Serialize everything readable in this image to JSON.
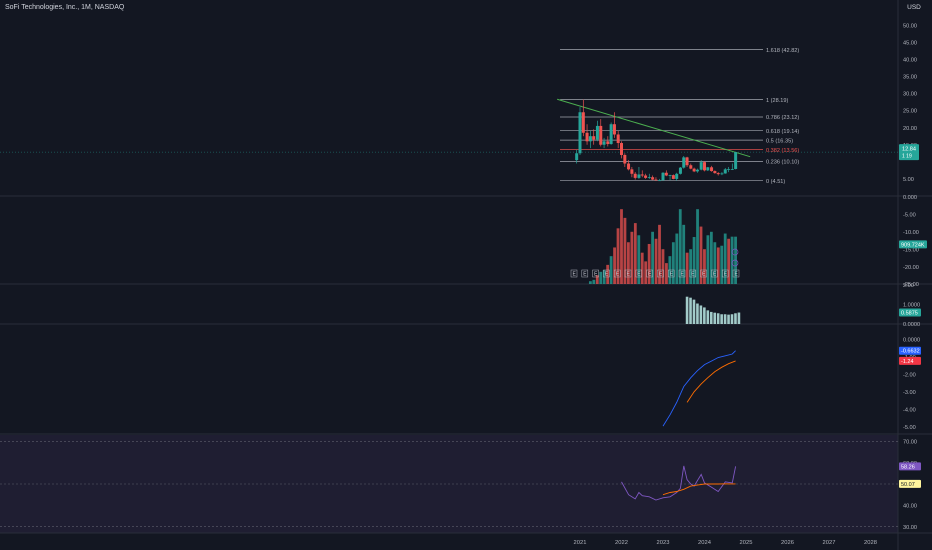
{
  "header": {
    "symbol_title": "SoFi Technologies, Inc., 1M, NASDAQ",
    "currency": "USD"
  },
  "colors": {
    "background": "#131722",
    "up": "#26a69a",
    "down": "#ef5350",
    "fib_line": "#b2b5be",
    "trendline": "#4caf50",
    "macd_line": "#2962ff",
    "signal_line": "#ff6d00",
    "rsi_line": "#7e57c2",
    "rsi_band": "#2a2440"
  },
  "time_axis": {
    "labels": [
      {
        "label": "2021",
        "t": 2021.0
      },
      {
        "label": "2022",
        "t": 2022.0
      },
      {
        "label": "2023",
        "t": 2023.0
      },
      {
        "label": "2024",
        "t": 2024.0
      },
      {
        "label": "2025",
        "t": 2025.0
      },
      {
        "label": "2026",
        "t": 2026.0
      },
      {
        "label": "2027",
        "t": 2027.0
      },
      {
        "label": "2028",
        "t": 2028.0
      }
    ]
  },
  "chart_data": [
    {
      "type": "candlestick",
      "pane": "price",
      "ylim": [
        0,
        55
      ],
      "y_ticks": [
        {
          "v": 50,
          "label": "50.00"
        },
        {
          "v": 45,
          "label": "45.00"
        },
        {
          "v": 40,
          "label": "40.00"
        },
        {
          "v": 35,
          "label": "35.00"
        },
        {
          "v": 30,
          "label": "30.00"
        },
        {
          "v": 25,
          "label": "25.00"
        },
        {
          "v": 20,
          "label": "20.00"
        },
        {
          "v": 15,
          "label": "15.00"
        },
        {
          "v": 5,
          "label": "5.00"
        }
      ],
      "fib_levels": [
        {
          "label": "1.618 (42.82)",
          "value": 42.82,
          "color": "#b2b5be"
        },
        {
          "label": "1 (28.19)",
          "value": 28.19,
          "color": "#b2b5be"
        },
        {
          "label": "0.786 (23.12)",
          "value": 23.12,
          "color": "#b2b5be"
        },
        {
          "label": "0.618 (19.14)",
          "value": 19.14,
          "color": "#b2b5be"
        },
        {
          "label": "0.5 (16.35)",
          "value": 16.35,
          "color": "#b2b5be"
        },
        {
          "label": "0.382 (13.56)",
          "value": 13.56,
          "color": "#ef5350"
        },
        {
          "label": "0.236 (10.10)",
          "value": 10.1,
          "color": "#b2b5be"
        },
        {
          "label": "0 (4.51)",
          "value": 4.51,
          "color": "#b2b5be"
        }
      ],
      "trendline": {
        "start": {
          "t": 2020.45,
          "v": 28.3
        },
        "end": {
          "t": 2025.1,
          "v": 11.5
        }
      },
      "last_price": {
        "label": "12.84",
        "sub_label": "1 19",
        "value": 12.84
      },
      "candles": [
        {
          "t": 2020.92,
          "o": 10.5,
          "h": 13.5,
          "l": 9.5,
          "c": 12.5
        },
        {
          "t": 2021.0,
          "o": 12.5,
          "h": 26.0,
          "l": 12.0,
          "c": 24.5
        },
        {
          "t": 2021.08,
          "o": 24.5,
          "h": 28.2,
          "l": 17.5,
          "c": 18.5
        },
        {
          "t": 2021.17,
          "o": 18.5,
          "h": 21.0,
          "l": 15.0,
          "c": 16.0
        },
        {
          "t": 2021.25,
          "o": 16.0,
          "h": 19.0,
          "l": 14.0,
          "c": 17.5
        },
        {
          "t": 2021.33,
          "o": 17.5,
          "h": 19.5,
          "l": 15.0,
          "c": 16.5
        },
        {
          "t": 2021.42,
          "o": 16.5,
          "h": 22.0,
          "l": 16.0,
          "c": 20.5
        },
        {
          "t": 2021.5,
          "o": 20.5,
          "h": 22.5,
          "l": 14.5,
          "c": 15.0
        },
        {
          "t": 2021.58,
          "o": 15.0,
          "h": 17.0,
          "l": 14.0,
          "c": 16.0
        },
        {
          "t": 2021.67,
          "o": 16.0,
          "h": 17.5,
          "l": 14.5,
          "c": 15.2
        },
        {
          "t": 2021.75,
          "o": 15.2,
          "h": 21.5,
          "l": 15.0,
          "c": 21.0
        },
        {
          "t": 2021.83,
          "o": 21.0,
          "h": 24.5,
          "l": 17.0,
          "c": 18.0
        },
        {
          "t": 2021.92,
          "o": 18.0,
          "h": 19.0,
          "l": 14.0,
          "c": 15.5
        },
        {
          "t": 2022.0,
          "o": 15.5,
          "h": 16.0,
          "l": 11.0,
          "c": 12.0
        },
        {
          "t": 2022.08,
          "o": 12.0,
          "h": 12.5,
          "l": 8.5,
          "c": 9.5
        },
        {
          "t": 2022.17,
          "o": 9.5,
          "h": 10.5,
          "l": 7.5,
          "c": 7.8
        },
        {
          "t": 2022.25,
          "o": 7.8,
          "h": 8.5,
          "l": 5.5,
          "c": 6.5
        },
        {
          "t": 2022.33,
          "o": 6.5,
          "h": 7.0,
          "l": 4.8,
          "c": 5.3
        },
        {
          "t": 2022.42,
          "o": 5.3,
          "h": 8.5,
          "l": 5.0,
          "c": 6.3
        },
        {
          "t": 2022.5,
          "o": 6.3,
          "h": 7.5,
          "l": 5.5,
          "c": 6.0
        },
        {
          "t": 2022.58,
          "o": 6.0,
          "h": 6.5,
          "l": 5.0,
          "c": 5.3
        },
        {
          "t": 2022.67,
          "o": 5.3,
          "h": 6.5,
          "l": 5.0,
          "c": 5.5
        },
        {
          "t": 2022.75,
          "o": 5.5,
          "h": 6.0,
          "l": 4.6,
          "c": 4.8
        },
        {
          "t": 2022.83,
          "o": 4.8,
          "h": 5.5,
          "l": 4.5,
          "c": 4.6
        },
        {
          "t": 2022.92,
          "o": 4.6,
          "h": 5.0,
          "l": 4.5,
          "c": 4.6
        },
        {
          "t": 2023.0,
          "o": 4.6,
          "h": 7.0,
          "l": 4.5,
          "c": 6.8
        },
        {
          "t": 2023.08,
          "o": 6.8,
          "h": 7.5,
          "l": 5.8,
          "c": 6.0
        },
        {
          "t": 2023.17,
          "o": 6.0,
          "h": 6.2,
          "l": 4.6,
          "c": 6.1
        },
        {
          "t": 2023.25,
          "o": 6.1,
          "h": 6.3,
          "l": 4.9,
          "c": 5.0
        },
        {
          "t": 2023.33,
          "o": 5.0,
          "h": 6.8,
          "l": 4.5,
          "c": 6.5
        },
        {
          "t": 2023.42,
          "o": 6.5,
          "h": 8.5,
          "l": 6.3,
          "c": 8.3
        },
        {
          "t": 2023.5,
          "o": 8.3,
          "h": 11.7,
          "l": 8.0,
          "c": 11.3
        },
        {
          "t": 2023.58,
          "o": 11.3,
          "h": 11.5,
          "l": 8.5,
          "c": 9.0
        },
        {
          "t": 2023.67,
          "o": 9.0,
          "h": 9.5,
          "l": 7.8,
          "c": 8.0
        },
        {
          "t": 2023.75,
          "o": 8.0,
          "h": 8.3,
          "l": 7.0,
          "c": 7.2
        },
        {
          "t": 2023.83,
          "o": 7.2,
          "h": 8.0,
          "l": 6.8,
          "c": 7.7
        },
        {
          "t": 2023.92,
          "o": 7.7,
          "h": 10.5,
          "l": 7.5,
          "c": 9.9
        },
        {
          "t": 2024.0,
          "o": 9.9,
          "h": 10.2,
          "l": 7.2,
          "c": 7.5
        },
        {
          "t": 2024.08,
          "o": 7.5,
          "h": 8.5,
          "l": 7.3,
          "c": 8.4
        },
        {
          "t": 2024.17,
          "o": 8.4,
          "h": 8.8,
          "l": 7.1,
          "c": 7.3
        },
        {
          "t": 2024.25,
          "o": 7.3,
          "h": 7.5,
          "l": 6.5,
          "c": 6.7
        },
        {
          "t": 2024.33,
          "o": 6.7,
          "h": 7.0,
          "l": 6.0,
          "c": 6.4
        },
        {
          "t": 2024.42,
          "o": 6.4,
          "h": 7.0,
          "l": 6.1,
          "c": 6.6
        },
        {
          "t": 2024.5,
          "o": 6.6,
          "h": 8.2,
          "l": 6.5,
          "c": 7.8
        },
        {
          "t": 2024.58,
          "o": 7.8,
          "h": 8.5,
          "l": 7.0,
          "c": 7.9
        },
        {
          "t": 2024.67,
          "o": 7.9,
          "h": 9.5,
          "l": 7.6,
          "c": 7.9
        },
        {
          "t": 2024.75,
          "o": 7.9,
          "h": 12.9,
          "l": 7.8,
          "c": 12.84
        }
      ]
    },
    {
      "type": "bar",
      "pane": "volume",
      "ylim": [
        -25,
        0
      ],
      "y_ticks": [
        {
          "v": 0,
          "label": "0.000"
        },
        {
          "v": -5,
          "label": "-5.00"
        },
        {
          "v": -10,
          "label": "-10.00"
        },
        {
          "v": -15,
          "label": "-15.00"
        },
        {
          "v": -20,
          "label": "-20.00"
        },
        {
          "v": -25,
          "label": "-25.00"
        }
      ],
      "last_value": {
        "label": "909.724K",
        "value": -13.6
      },
      "values": [
        0.8,
        1.2,
        2.5,
        3.5,
        4.0,
        5.5,
        8.0,
        10.5,
        16.0,
        21.5,
        19.0,
        12.0,
        15.0,
        17.5,
        14.0,
        9.0,
        6.5,
        11.5,
        15.0,
        13.0,
        17.0,
        10.0,
        6.0,
        8.0,
        12.0,
        14.5,
        21.5,
        17.0,
        9.0,
        10.0,
        13.5,
        21.5,
        16.5,
        10.0,
        14.0,
        15.0,
        12.0,
        10.5,
        11.0,
        14.5,
        13.0,
        13.6,
        13.6
      ],
      "bar_colors": [
        "up",
        "up",
        "down",
        "up",
        "up",
        "down",
        "up",
        "down",
        "down",
        "down",
        "down",
        "down",
        "down",
        "down",
        "up",
        "down",
        "down",
        "down",
        "up",
        "down",
        "down",
        "down",
        "down",
        "up",
        "up",
        "up",
        "up",
        "up",
        "down",
        "up",
        "up",
        "up",
        "down",
        "down",
        "up",
        "up",
        "up",
        "down",
        "up",
        "up",
        "down",
        "up",
        "up"
      ],
      "event_markers": [
        "E",
        "E",
        "E",
        "E",
        "E",
        "E",
        "E",
        "E",
        "E",
        "E",
        "E",
        "E",
        "E",
        "E",
        "E",
        "E"
      ]
    },
    {
      "type": "bar",
      "pane": "oscillator",
      "ylim": [
        0,
        2
      ],
      "y_ticks": [
        {
          "v": 2,
          "label": "2.00"
        },
        {
          "v": 1,
          "label": "1.0000"
        },
        {
          "v": 0,
          "label": "0.0000"
        }
      ],
      "last_value": {
        "label": "0.5875",
        "value": 0.5875
      },
      "values": [
        1.4,
        1.35,
        1.25,
        1.05,
        0.95,
        0.85,
        0.7,
        0.62,
        0.58,
        0.55,
        0.5,
        0.5,
        0.48,
        0.5,
        0.55,
        0.5875
      ]
    },
    {
      "type": "line",
      "pane": "macd",
      "ylim": [
        -5,
        0
      ],
      "y_ticks": [
        {
          "v": 0,
          "label": "0.0000"
        },
        {
          "v": -1,
          "label": "-1.00"
        },
        {
          "v": -2,
          "label": "-2.00"
        },
        {
          "v": -3,
          "label": "-3.00"
        },
        {
          "v": -4,
          "label": "-4.00"
        },
        {
          "v": -5,
          "label": "-5.00"
        }
      ],
      "series": [
        {
          "color": "#2962ff",
          "last_label": "-0.6632",
          "points": [
            [
              2023.0,
              -4.95
            ],
            [
              2023.17,
              -4.3
            ],
            [
              2023.33,
              -3.6
            ],
            [
              2023.5,
              -2.7
            ],
            [
              2023.67,
              -2.2
            ],
            [
              2023.83,
              -1.8
            ],
            [
              2024.0,
              -1.45
            ],
            [
              2024.17,
              -1.25
            ],
            [
              2024.33,
              -1.05
            ],
            [
              2024.5,
              -0.95
            ],
            [
              2024.67,
              -0.85
            ],
            [
              2024.75,
              -0.6632
            ]
          ]
        },
        {
          "color": "#ff6d00",
          "last_label": "-1.24",
          "points": [
            [
              2023.58,
              -3.6
            ],
            [
              2023.75,
              -3.0
            ],
            [
              2023.92,
              -2.55
            ],
            [
              2024.08,
              -2.2
            ],
            [
              2024.25,
              -1.85
            ],
            [
              2024.42,
              -1.6
            ],
            [
              2024.58,
              -1.4
            ],
            [
              2024.75,
              -1.24
            ]
          ]
        }
      ]
    },
    {
      "type": "line",
      "pane": "rsi",
      "ylim": [
        30,
        70
      ],
      "y_ticks": [
        {
          "v": 70,
          "label": "70.00"
        },
        {
          "v": 60,
          "label": "60.00"
        },
        {
          "v": 50,
          "label": "50.00"
        },
        {
          "v": 40,
          "label": "40.00"
        },
        {
          "v": 30,
          "label": "30.00"
        }
      ],
      "series": [
        {
          "color": "#7e57c2",
          "last_label": "58.26",
          "points": [
            [
              2022.0,
              51.0
            ],
            [
              2022.17,
              45.0
            ],
            [
              2022.33,
              43.0
            ],
            [
              2022.42,
              46.0
            ],
            [
              2022.5,
              44.5
            ],
            [
              2022.67,
              44.0
            ],
            [
              2022.83,
              42.5
            ],
            [
              2023.0,
              43.5
            ],
            [
              2023.17,
              44.0
            ],
            [
              2023.33,
              46.0
            ],
            [
              2023.42,
              48.0
            ],
            [
              2023.5,
              58.5
            ],
            [
              2023.58,
              52.0
            ],
            [
              2023.67,
              50.0
            ],
            [
              2023.75,
              49.0
            ],
            [
              2023.92,
              54.5
            ],
            [
              2024.0,
              50.5
            ],
            [
              2024.17,
              48.5
            ],
            [
              2024.33,
              46.5
            ],
            [
              2024.5,
              51.0
            ],
            [
              2024.67,
              50.5
            ],
            [
              2024.75,
              58.26
            ]
          ]
        },
        {
          "color": "#ff6d00",
          "last_label": "50.07",
          "points": [
            [
              2023.0,
              45.0
            ],
            [
              2023.17,
              46.0
            ],
            [
              2023.33,
              46.5
            ],
            [
              2023.5,
              47.5
            ],
            [
              2023.67,
              49.0
            ],
            [
              2023.83,
              49.5
            ],
            [
              2024.0,
              50.0
            ],
            [
              2024.17,
              50.0
            ],
            [
              2024.33,
              50.0
            ],
            [
              2024.5,
              50.1
            ],
            [
              2024.75,
              50.07
            ]
          ]
        }
      ]
    }
  ]
}
